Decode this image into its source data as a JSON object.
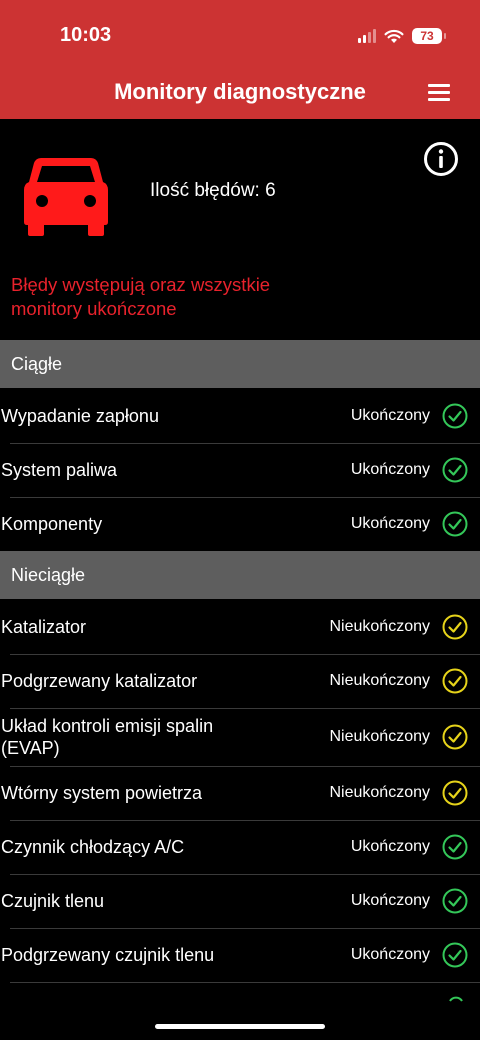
{
  "status_bar": {
    "time": "10:03",
    "battery": "73"
  },
  "header": {
    "title": "Monitory diagnostyczne"
  },
  "summary": {
    "error_count": "Ilość błędów: 6",
    "message": "Błędy występują oraz wszystkie monitory ukończone"
  },
  "colors": {
    "header": "#cc3333",
    "alert": "#e8222c",
    "complete": "#34c759",
    "incomplete": "#e6d31a",
    "section": "#5e5e5e"
  },
  "sections": [
    {
      "label": "Ciągłe",
      "items": [
        {
          "label": "Wypadanie zapłonu",
          "status": "Ukończony",
          "icon": "check-circle-green-icon"
        },
        {
          "label": "System paliwa",
          "status": "Ukończony",
          "icon": "check-circle-green-icon"
        },
        {
          "label": "Komponenty",
          "status": "Ukończony",
          "icon": "check-circle-green-icon"
        }
      ]
    },
    {
      "label": "Nieciągłe",
      "items": [
        {
          "label": "Katalizator",
          "status": "Nieukończony",
          "icon": "check-circle-yellow-icon"
        },
        {
          "label": "Podgrzewany katalizator",
          "status": "Nieukończony",
          "icon": "check-circle-yellow-icon"
        },
        {
          "label": "Układ kontroli emisji spalin\n(EVAP)",
          "status": "Nieukończony",
          "icon": "check-circle-yellow-icon"
        },
        {
          "label": "Wtórny system powietrza",
          "status": "Nieukończony",
          "icon": "check-circle-yellow-icon"
        },
        {
          "label": "Czynnik chłodzący A/C",
          "status": "Ukończony",
          "icon": "check-circle-green-icon"
        },
        {
          "label": "Czujnik tlenu",
          "status": "Ukończony",
          "icon": "check-circle-green-icon"
        },
        {
          "label": "Podgrzewany czujnik tlenu",
          "status": "Ukończony",
          "icon": "check-circle-green-icon"
        }
      ]
    }
  ]
}
